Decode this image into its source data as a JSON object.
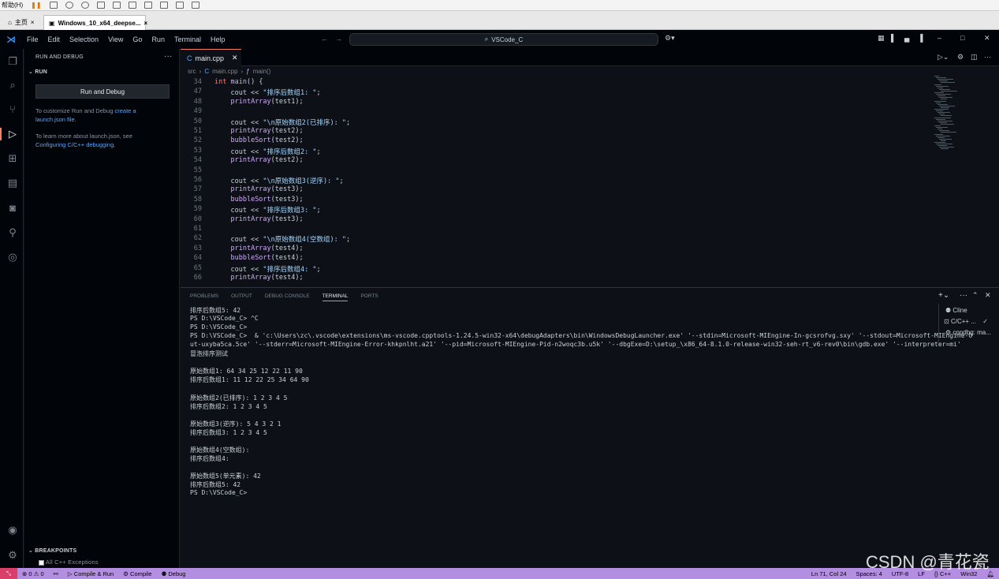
{
  "vm_toolbar": {
    "label": "帮助(H)"
  },
  "vm_tabs": [
    {
      "label": "主页"
    },
    {
      "label": "Windows_10_x64_deepse..."
    }
  ],
  "menu": [
    "File",
    "Edit",
    "Selection",
    "View",
    "Go",
    "Run",
    "Terminal",
    "Help"
  ],
  "command_center": "VSCode_C",
  "sidebar": {
    "title": "RUN AND DEBUG",
    "section": "RUN",
    "run_button": "Run and Debug",
    "text1_pre": "To customize Run and Debug ",
    "text1_link": "create a launch.json file.",
    "text2_pre": "To learn more about launch.json, see ",
    "text2_link": "Configuring C/C++ debugging.",
    "breakpoints": "BREAKPOINTS",
    "bp_item": "All C++ Exceptions"
  },
  "editor": {
    "tab": "main.cpp",
    "breadcrumb": [
      "src",
      "main.cpp",
      "main()"
    ],
    "lines": [
      {
        "n": "34",
        "segs": [
          [
            "kw",
            "int "
          ],
          [
            "fn",
            "main"
          ],
          [
            "id",
            "() {"
          ]
        ]
      },
      {
        "n": "47",
        "segs": [
          [
            "id",
            "    cout << "
          ],
          [
            "str",
            "\"排序后数组1: \""
          ],
          [
            "id",
            ";"
          ]
        ]
      },
      {
        "n": "48",
        "segs": [
          [
            "id",
            "    "
          ],
          [
            "fn",
            "printArray"
          ],
          [
            "id",
            "(test1);"
          ]
        ]
      },
      {
        "n": "49",
        "segs": []
      },
      {
        "n": "50",
        "segs": [
          [
            "id",
            "    cout << "
          ],
          [
            "str",
            "\"\\n原始数组2(已排序): \""
          ],
          [
            "id",
            ";"
          ]
        ]
      },
      {
        "n": "51",
        "segs": [
          [
            "id",
            "    "
          ],
          [
            "fn",
            "printArray"
          ],
          [
            "id",
            "(test2);"
          ]
        ]
      },
      {
        "n": "52",
        "segs": [
          [
            "id",
            "    "
          ],
          [
            "fn",
            "bubbleSort"
          ],
          [
            "id",
            "(test2);"
          ]
        ]
      },
      {
        "n": "53",
        "segs": [
          [
            "id",
            "    cout << "
          ],
          [
            "str",
            "\"排序后数组2: \""
          ],
          [
            "id",
            ";"
          ]
        ]
      },
      {
        "n": "54",
        "segs": [
          [
            "id",
            "    "
          ],
          [
            "fn",
            "printArray"
          ],
          [
            "id",
            "(test2);"
          ]
        ]
      },
      {
        "n": "55",
        "segs": []
      },
      {
        "n": "56",
        "segs": [
          [
            "id",
            "    cout << "
          ],
          [
            "str",
            "\"\\n原始数组3(逆序): \""
          ],
          [
            "id",
            ";"
          ]
        ]
      },
      {
        "n": "57",
        "segs": [
          [
            "id",
            "    "
          ],
          [
            "fn",
            "printArray"
          ],
          [
            "id",
            "(test3);"
          ]
        ]
      },
      {
        "n": "58",
        "segs": [
          [
            "id",
            "    "
          ],
          [
            "fn",
            "bubbleSort"
          ],
          [
            "id",
            "(test3);"
          ]
        ]
      },
      {
        "n": "59",
        "segs": [
          [
            "id",
            "    cout << "
          ],
          [
            "str",
            "\"排序后数组3: \""
          ],
          [
            "id",
            ";"
          ]
        ]
      },
      {
        "n": "60",
        "segs": [
          [
            "id",
            "    "
          ],
          [
            "fn",
            "printArray"
          ],
          [
            "id",
            "(test3);"
          ]
        ]
      },
      {
        "n": "61",
        "segs": []
      },
      {
        "n": "62",
        "segs": [
          [
            "id",
            "    cout << "
          ],
          [
            "str",
            "\"\\n原始数组4(空数组): \""
          ],
          [
            "id",
            ";"
          ]
        ]
      },
      {
        "n": "63",
        "segs": [
          [
            "id",
            "    "
          ],
          [
            "fn",
            "printArray"
          ],
          [
            "id",
            "(test4);"
          ]
        ]
      },
      {
        "n": "64",
        "segs": [
          [
            "id",
            "    "
          ],
          [
            "fn",
            "bubbleSort"
          ],
          [
            "id",
            "(test4);"
          ]
        ]
      },
      {
        "n": "65",
        "segs": [
          [
            "id",
            "    cout << "
          ],
          [
            "str",
            "\"排序后数组4: \""
          ],
          [
            "id",
            ";"
          ]
        ]
      },
      {
        "n": "66",
        "segs": [
          [
            "id",
            "    "
          ],
          [
            "fn",
            "printArray"
          ],
          [
            "id",
            "(test4);"
          ]
        ]
      }
    ]
  },
  "panel": {
    "tabs": [
      "PROBLEMS",
      "OUTPUT",
      "DEBUG CONSOLE",
      "TERMINAL",
      "PORTS"
    ],
    "active_tab": "TERMINAL",
    "terminal_lines": [
      "排序后数组5: 42",
      "PS D:\\VSCode_C> ^C",
      "PS D:\\VSCode_C>",
      "PS D:\\VSCode_C>  & 'c:\\Users\\zc\\.vscode\\extensions\\ms-vscode.cpptools-1.24.5-win32-x64\\debugAdapters\\bin\\WindowsDebugLauncher.exe' '--stdin=Microsoft-MIEngine-In-gcsrofvg.sxy' '--stdout=Microsoft-MIEngine-O",
      "ut-uxyba5ca.5ce' '--stderr=Microsoft-MIEngine-Error-khkpnlht.a21' '--pid=Microsoft-MIEngine-Pid-n2woqc3b.u5k' '--dbgExe=D:\\setup_\\x86_64-8.1.0-release-win32-seh-rt_v6-rev0\\bin\\gdb.exe' '--interpreter=mi'",
      "冒泡排序测试",
      "",
      "原始数组1: 64 34 25 12 22 11 90",
      "排序后数组1: 11 12 22 25 34 64 90",
      "",
      "原始数组2(已排序): 1 2 3 4 5",
      "排序后数组2: 1 2 3 4 5",
      "",
      "原始数组3(逆序): 5 4 3 2 1",
      "排序后数组3: 1 2 3 4 5",
      "",
      "原始数组4(空数组):",
      "排序后数组4:",
      "",
      "原始数组5(单元素): 42",
      "排序后数组5: 42",
      "PS D:\\VSCode_C>"
    ],
    "terminal_list": [
      "Cline",
      "C/C++ ...",
      "cppdbg: ma..."
    ]
  },
  "status": {
    "problems": "0",
    "warnings": "0",
    "compile_run": "Compile & Run",
    "compile": "Compile",
    "debug": "Debug",
    "position": "Ln 71, Col 24",
    "spaces": "Spaces: 4",
    "encoding": "UTF-8",
    "eol": "LF",
    "language": "C++",
    "platform": "Win32"
  },
  "watermark": "CSDN @青花瓷"
}
